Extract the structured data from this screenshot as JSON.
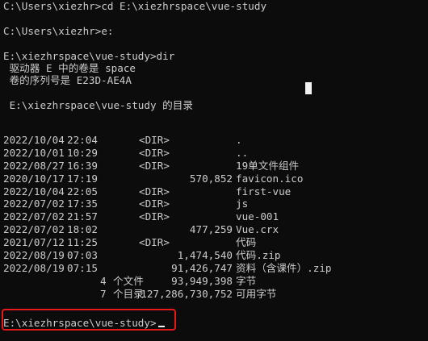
{
  "terminal": {
    "header_lines": [
      "C:\\Users\\xiezhr>cd E:\\xiezhrspace\\vue-study",
      "",
      "C:\\Users\\xiezhr>e:",
      "",
      "E:\\xiezhrspace\\vue-study>dir",
      " 驱动器 E 中的卷是 space",
      " 卷的序列号是 E23D-AE4A",
      "",
      " E:\\xiezhrspace\\vue-study 的目录",
      ""
    ],
    "entries": [
      {
        "date": "2022/10/04",
        "time": "22:04",
        "dir": "<DIR>",
        "size": "",
        "name": "."
      },
      {
        "date": "2022/10/01",
        "time": "10:29",
        "dir": "<DIR>",
        "size": "",
        "name": ".."
      },
      {
        "date": "2022/08/27",
        "time": "16:39",
        "dir": "<DIR>",
        "size": "",
        "name": "19单文件组件"
      },
      {
        "date": "2020/10/17",
        "time": "17:19",
        "dir": "",
        "size": "570,852",
        "name": "favicon.ico"
      },
      {
        "date": "2022/10/04",
        "time": "22:05",
        "dir": "<DIR>",
        "size": "",
        "name": "first-vue"
      },
      {
        "date": "2022/07/02",
        "time": "17:35",
        "dir": "<DIR>",
        "size": "",
        "name": "js"
      },
      {
        "date": "2022/07/02",
        "time": "21:57",
        "dir": "<DIR>",
        "size": "",
        "name": "vue-001"
      },
      {
        "date": "2022/07/02",
        "time": "18:02",
        "dir": "",
        "size": "477,259",
        "name": "Vue.crx"
      },
      {
        "date": "2021/07/12",
        "time": "11:25",
        "dir": "<DIR>",
        "size": "",
        "name": "代码"
      },
      {
        "date": "2022/08/19",
        "time": "07:03",
        "dir": "",
        "size": "1,474,540",
        "name": "代码.zip"
      },
      {
        "date": "2022/08/19",
        "time": "07:15",
        "dir": "",
        "size": "91,426,747",
        "name": "资料（含课件）.zip"
      }
    ],
    "summary": {
      "files_count": "4",
      "files_label": "个文件",
      "files_bytes": "93,949,398",
      "files_unit": "字节",
      "dirs_count": "7",
      "dirs_label": "个目录",
      "dirs_bytes": "127,286,730,752",
      "dirs_unit": "可用字节"
    },
    "current_prompt": "E:\\xiezhrspace\\vue-study>"
  },
  "colors": {
    "background": "#0c0c0c",
    "text": "#cccccc",
    "highlight": "#e8191a"
  }
}
